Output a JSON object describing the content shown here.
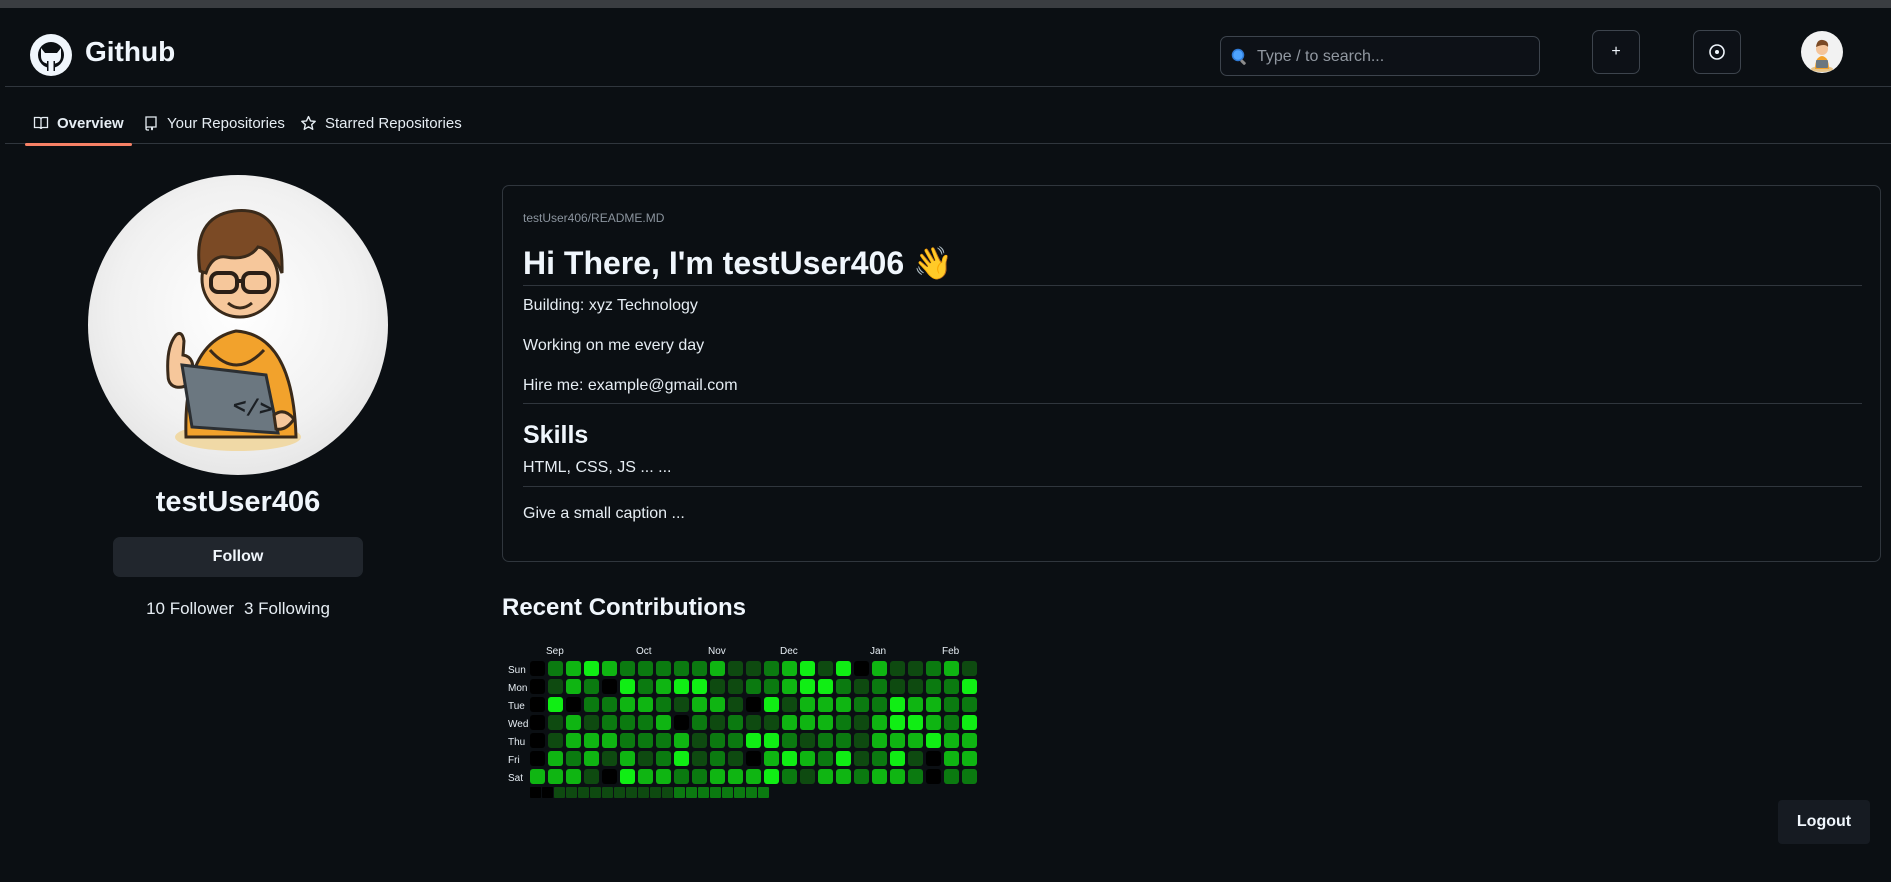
{
  "header": {
    "brand": "Github",
    "search_placeholder": "Type / to search...",
    "plus_label": "+",
    "icons": {
      "logo": "github-octocat-icon",
      "search": "magnifier-icon",
      "issues": "circle-dot-icon"
    }
  },
  "tabs": [
    {
      "label": "Overview",
      "icon": "book-icon",
      "active": true
    },
    {
      "label": "Your Repositories",
      "icon": "repo-icon",
      "active": false
    },
    {
      "label": "Starred Repositories",
      "icon": "star-icon",
      "active": false
    }
  ],
  "profile": {
    "username": "testUser406",
    "follow_label": "Follow",
    "followers": "10 Follower",
    "following": "3 Following"
  },
  "readme": {
    "path": "testUser406/README.MD",
    "heading": "Hi There, I'm testUser406 👋",
    "building": "Building: xyz Technology",
    "working": "Working on me every day",
    "hire": "Hire me: example@gmail.com",
    "skills_heading": "Skills",
    "skills": "HTML, CSS, JS ... ...",
    "caption": "Give a small caption ..."
  },
  "contributions": {
    "title": "Recent Contributions",
    "months": [
      "Sep",
      "Oct",
      "Nov",
      "Dec",
      "Jan",
      "Feb"
    ],
    "days": [
      "Sun",
      "Mon",
      "Tue",
      "Wed",
      "Thu",
      "Fri",
      "Sat"
    ],
    "levels_grid": [
      [
        0,
        2,
        3,
        4,
        3,
        2,
        2,
        2,
        2,
        2,
        3,
        1,
        1,
        2,
        3,
        4,
        1,
        4,
        0,
        3,
        1,
        1,
        2,
        3,
        1
      ],
      [
        0,
        1,
        3,
        2,
        0,
        4,
        2,
        3,
        4,
        4,
        1,
        1,
        2,
        2,
        3,
        4,
        4,
        2,
        1,
        2,
        1,
        1,
        2,
        2,
        4
      ],
      [
        0,
        4,
        0,
        2,
        2,
        3,
        3,
        2,
        1,
        3,
        3,
        1,
        0,
        4,
        1,
        3,
        3,
        3,
        2,
        2,
        4,
        3,
        3,
        2,
        2
      ],
      [
        0,
        1,
        3,
        1,
        2,
        2,
        2,
        3,
        0,
        2,
        1,
        2,
        1,
        1,
        3,
        3,
        3,
        2,
        1,
        3,
        4,
        4,
        3,
        2,
        4
      ],
      [
        0,
        1,
        3,
        3,
        3,
        2,
        2,
        2,
        3,
        1,
        2,
        2,
        4,
        4,
        2,
        1,
        2,
        2,
        1,
        3,
        3,
        3,
        4,
        3,
        3
      ],
      [
        0,
        3,
        2,
        3,
        1,
        3,
        1,
        2,
        4,
        1,
        2,
        1,
        0,
        3,
        4,
        3,
        2,
        4,
        1,
        2,
        4,
        1,
        0,
        3,
        3
      ],
      [
        3,
        3,
        3,
        1,
        0,
        4,
        3,
        3,
        2,
        2,
        3,
        3,
        3,
        4,
        2,
        1,
        3,
        3,
        2,
        3,
        3,
        2,
        0,
        2,
        2
      ],
      [
        0,
        0,
        1,
        1,
        1,
        1,
        1,
        1,
        1,
        1,
        1,
        1,
        2,
        2,
        2,
        2,
        2,
        2,
        2,
        2
      ]
    ],
    "level_colors": [
      "#000000",
      "#0e4a10",
      "#0b7a10",
      "#0fb512",
      "#10ee14"
    ]
  },
  "logout_label": "Logout"
}
